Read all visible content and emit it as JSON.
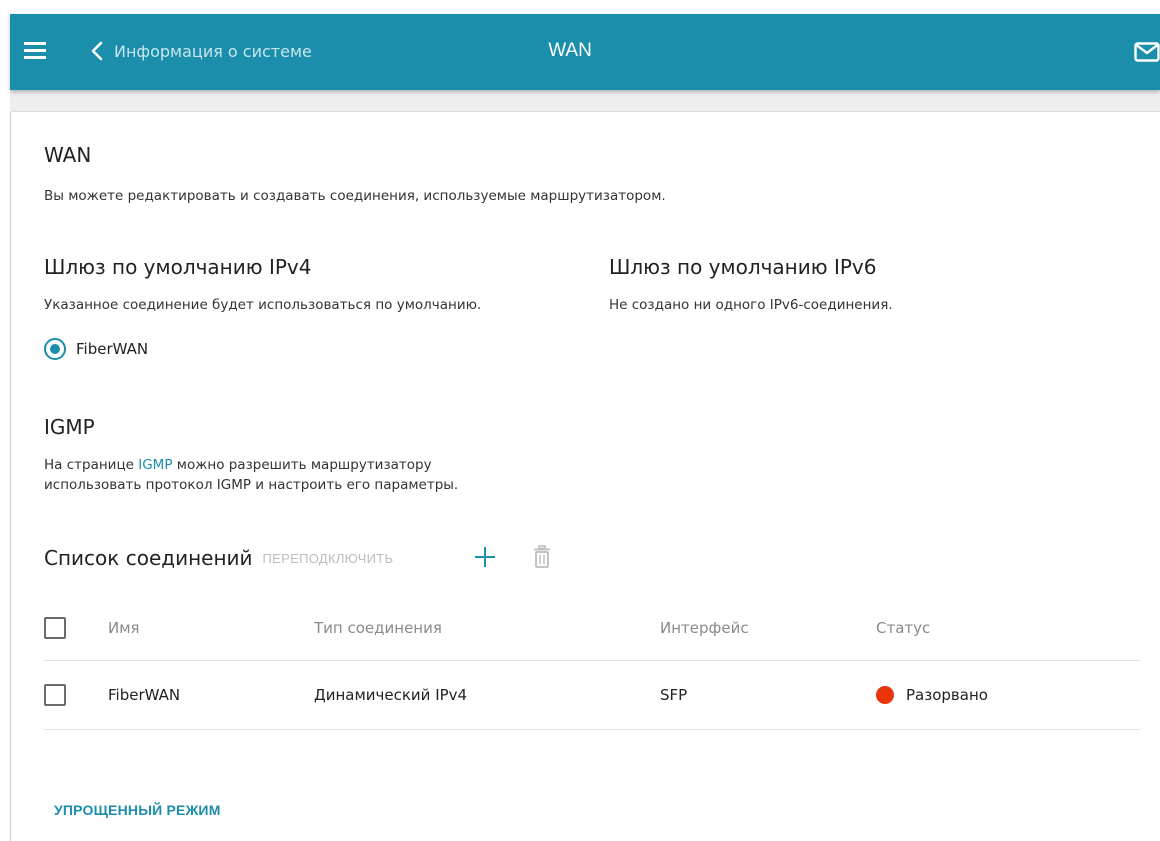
{
  "header": {
    "back_label": "Информация о системе",
    "title": "WAN",
    "menu_icon": "hamburger-menu-icon",
    "back_icon": "chevron-left-icon",
    "mail_icon": "envelope-icon",
    "color": "#1b8eab"
  },
  "main": {
    "section_title": "WAN",
    "description": "Вы можете редактировать и создавать соединения, используемые маршрутизатором.",
    "ipv4": {
      "title": "Шлюз по умолчанию IPv4",
      "text": "Указанное соединение будет использоваться по умолчанию.",
      "selected_connection": "FiberWAN"
    },
    "ipv6": {
      "title": "Шлюз по умолчанию IPv6",
      "text": "Не создано ни одного IPv6-соединения."
    },
    "igmp": {
      "title": "IGMP",
      "text_before": "На странице ",
      "link": "IGMP",
      "text_after": " можно разрешить маршрутизатору",
      "text_line2": "использовать протокол IGMP и настроить его параметры."
    },
    "connections": {
      "title": "Список соединений",
      "reconnect_label": "ПЕРЕПОДКЛЮЧИТЬ",
      "add_icon": "plus-icon",
      "delete_icon": "trash-icon",
      "columns": [
        "Имя",
        "Тип соединения",
        "Интерфейс",
        "Статус"
      ],
      "rows": [
        {
          "name": "FiberWAN",
          "type": "Динамический IPv4",
          "interface": "SFP",
          "status": "Разорвано",
          "status_color": "#e8340b"
        }
      ]
    },
    "simple_mode_label": "УПРОЩЕННЫЙ РЕЖИМ"
  }
}
